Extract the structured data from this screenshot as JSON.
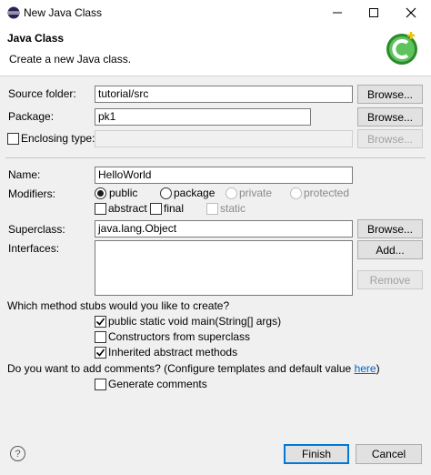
{
  "window": {
    "title": "New Java Class",
    "minimize_icon": "minimize-icon",
    "maximize_icon": "maximize-icon",
    "close_icon": "close-icon"
  },
  "header": {
    "title": "Java Class",
    "subtitle": "Create a new Java class.",
    "icon": "java-class-wizard-icon"
  },
  "form": {
    "source_folder": {
      "label": "Source folder:",
      "value": "tutorial/src",
      "browse": "Browse..."
    },
    "package": {
      "label": "Package:",
      "value": "pk1",
      "browse": "Browse..."
    },
    "enclosing_type": {
      "label": "Enclosing type:",
      "value": "",
      "checked": false,
      "browse": "Browse..."
    },
    "name": {
      "label": "Name:",
      "value": "HelloWorld"
    },
    "modifiers": {
      "label": "Modifiers:",
      "visibility_options": [
        {
          "label": "public",
          "selected": true,
          "enabled": true
        },
        {
          "label": "package",
          "selected": false,
          "enabled": true
        },
        {
          "label": "private",
          "selected": false,
          "enabled": false
        },
        {
          "label": "protected",
          "selected": false,
          "enabled": false
        }
      ],
      "flags": [
        {
          "label": "abstract",
          "checked": false,
          "enabled": true
        },
        {
          "label": "final",
          "checked": false,
          "enabled": true
        },
        {
          "label": "static",
          "checked": false,
          "enabled": false
        }
      ]
    },
    "superclass": {
      "label": "Superclass:",
      "value": "java.lang.Object",
      "browse": "Browse..."
    },
    "interfaces": {
      "label": "Interfaces:",
      "add": "Add...",
      "remove": "Remove"
    },
    "stubs": {
      "question": "Which method stubs would you like to create?",
      "options": [
        {
          "label": "public static void main(String[] args)",
          "checked": true
        },
        {
          "label": "Constructors from superclass",
          "checked": false
        },
        {
          "label": "Inherited abstract methods",
          "checked": true
        }
      ]
    },
    "comments": {
      "question": "Do you want to add comments? (Configure templates and default value ",
      "link": "here",
      "question_end": ")",
      "option": {
        "label": "Generate comments",
        "checked": false
      }
    }
  },
  "footer": {
    "help_icon": "help-icon",
    "help_glyph": "?",
    "finish": "Finish",
    "cancel": "Cancel"
  }
}
